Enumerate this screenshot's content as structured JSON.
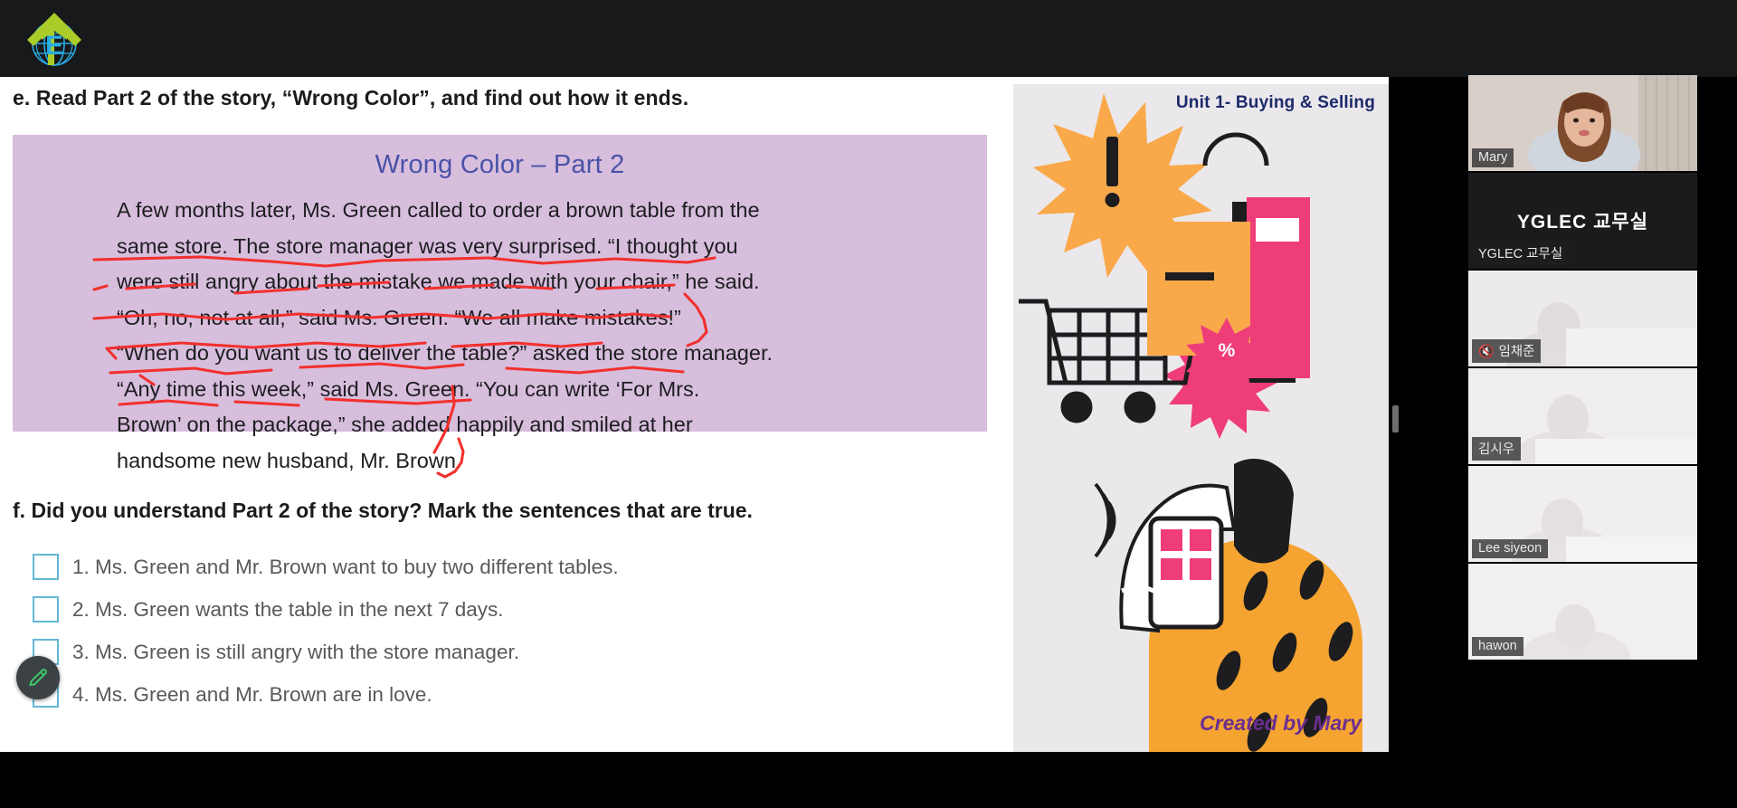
{
  "app": {
    "background_color": "#000000",
    "logo_name": "yglec-logo"
  },
  "worksheet": {
    "question_e": "e. Read Part 2 of the story, “Wrong Color”, and find out how it ends.",
    "story_title": "Wrong Color – Part 2",
    "story_text": "A few months later, Ms. Green called to order a brown table from the same store. The store manager was very surprised. “I thought you were still angry about the mistake we made with your chair,” he said. “Oh, no, not at all,” said Ms. Green. “We all make mistakes!” “When do you want us to deliver the table?” asked the store manager. “Any time this week,” said Ms. Green. “You can write ‘For Mrs. Brown’ on the package,” she added happily and smiled at her handsome new husband, Mr. Brown.",
    "story_lines": [
      "A few months later, Ms. Green called to order a brown table from the",
      "same store. The store manager was very surprised. “I thought you",
      "were still angry about the mistake we made with your chair,” he said.",
      "“Oh, no, not at all,” said Ms. Green. “We all make mistakes!”",
      "“When do you want us to deliver the table?” asked the store manager.",
      "“Any time this week,” said Ms. Green. “You can write ‘For Mrs.",
      "Brown’ on the package,” she added happily and smiled at her",
      "handsome new husband, Mr. Brown."
    ],
    "question_f": "f. Did you understand Part 2 of the story? Mark the sentences that are true.",
    "choices": [
      {
        "label": "1. Ms. Green and Mr. Brown want to buy two different tables.",
        "checked": false
      },
      {
        "label": "2. Ms. Green wants the table in the next 7 days.",
        "checked": false
      },
      {
        "label": "3. Ms. Green is still angry with the store manager.",
        "checked": false
      },
      {
        "label": "4. Ms. Green and Mr. Brown are in love.",
        "checked": false
      }
    ],
    "story_bg_color": "#d7bedd",
    "title_color": "#4a52a8",
    "checkbox_color": "#63b7d4",
    "annotation_color": "#f2302d"
  },
  "illustration": {
    "unit_label": "Unit 1- Buying & Selling",
    "created_by": "Created by Mary",
    "unit_color": "#1c2a6b",
    "created_by_color": "#6b2f8f",
    "background_color": "#ebe8ec"
  },
  "toolbar": {
    "pen_tool_name": "pen-tool",
    "pen_color": "#3fc46b"
  },
  "participants": [
    {
      "name": "Mary",
      "muted": false,
      "active": false,
      "has_video": true,
      "initials": ""
    },
    {
      "name": "YGLEC 교무실",
      "muted": false,
      "active": false,
      "has_video": false,
      "initials": "YGLEC 교무실"
    },
    {
      "name": "임채준",
      "muted": true,
      "active": false,
      "has_video": true,
      "initials": ""
    },
    {
      "name": "김시우",
      "muted": false,
      "active": false,
      "has_video": true,
      "initials": ""
    },
    {
      "name": "Lee siyeon",
      "muted": false,
      "active": false,
      "has_video": true,
      "initials": ""
    },
    {
      "name": "hawon",
      "muted": false,
      "active": true,
      "has_video": true,
      "initials": ""
    }
  ]
}
